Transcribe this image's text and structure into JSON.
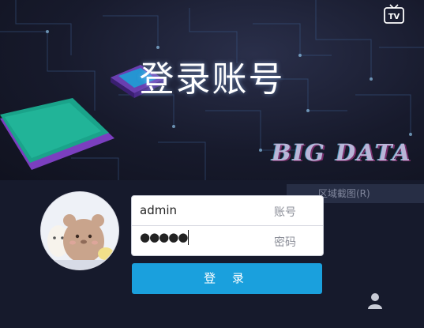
{
  "header": {
    "title": "登录账号",
    "banner_text": "BIG DATA",
    "tv_label": "TV"
  },
  "overlay": {
    "tooltip_text": "区域截图(R)"
  },
  "login_form": {
    "username": {
      "value": "admin",
      "label": "账号"
    },
    "password": {
      "value": "●●●●●",
      "label": "密码"
    },
    "submit_label": "登 录"
  },
  "icons": [
    "tv-icon",
    "avatar",
    "user-icon"
  ],
  "colors": {
    "button": "#1aa0dd",
    "background": "#161a2c"
  }
}
